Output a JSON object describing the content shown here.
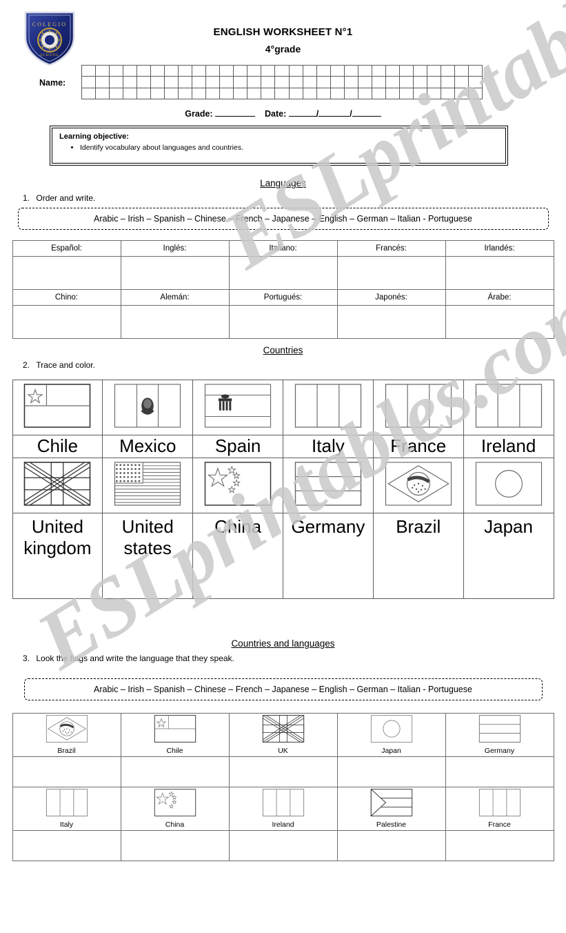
{
  "watermark": {
    "text": "ESLprintables.com"
  },
  "header": {
    "logo_alt": "school-crest-logo",
    "logo_text": "COLEGIO",
    "title": "ENGLISH WORKSHEET N°1",
    "subtitle": "4°grade"
  },
  "name_row": {
    "label": "Name:",
    "cell_columns": 29,
    "cell_rows": 3
  },
  "grade_date": {
    "grade_label": "Grade:",
    "date_label": "Date:",
    "separator": "/"
  },
  "objective": {
    "title": "Learning objective:",
    "items": [
      "Identify vocabulary about languages and countries."
    ]
  },
  "section1": {
    "heading": "Languages",
    "number": "1.",
    "instruction": "Order and write.",
    "wordbank": "Arabic – Irish – Spanish – Chinese – French – Japanese – English – German – Italian - Portuguese",
    "table_rows": [
      [
        "Español:",
        "Inglés:",
        "Italiano:",
        "Francés:",
        "Irlandés:"
      ],
      [
        "Chino:",
        "Alemán:",
        "Portugués:",
        "Japonés:",
        "Árabe:"
      ]
    ]
  },
  "section2": {
    "heading": "Countries",
    "number": "2.",
    "instruction": "Trace and color.",
    "rows": [
      [
        {
          "country": "Chile",
          "flag": "chile-flag"
        },
        {
          "country": "Mexico",
          "flag": "mexico-flag"
        },
        {
          "country": "Spain",
          "flag": "spain-flag"
        },
        {
          "country": "Italy",
          "flag": "italy-flag"
        },
        {
          "country": "France",
          "flag": "france-flag"
        },
        {
          "country": "Ireland",
          "flag": "ireland-flag"
        }
      ],
      [
        {
          "country": "United kingdom",
          "flag": "uk-flag"
        },
        {
          "country": "United states",
          "flag": "usa-flag"
        },
        {
          "country": "China",
          "flag": "china-flag"
        },
        {
          "country": "Germany",
          "flag": "germany-flag"
        },
        {
          "country": "Brazil",
          "flag": "brazil-flag"
        },
        {
          "country": "Japan",
          "flag": "japan-flag"
        }
      ]
    ]
  },
  "section3": {
    "heading": "Countries and languages",
    "number": "3.",
    "instruction": "Look the flags and write the language that they speak.",
    "wordbank": "Arabic – Irish – Spanish – Chinese – French – Japanese – English – German – Italian - Portuguese",
    "rows": [
      [
        {
          "country": "Brazil",
          "flag": "brazil-flag"
        },
        {
          "country": "Chile",
          "flag": "chile-flag"
        },
        {
          "country": "UK",
          "flag": "uk-flag"
        },
        {
          "country": "Japan",
          "flag": "japan-flag"
        },
        {
          "country": "Germany",
          "flag": "germany-flag"
        }
      ],
      [
        {
          "country": "Italy",
          "flag": "italy-flag"
        },
        {
          "country": "China",
          "flag": "china-flag"
        },
        {
          "country": "Ireland",
          "flag": "ireland-flag"
        },
        {
          "country": "Palestine",
          "flag": "palestine-flag"
        },
        {
          "country": "France",
          "flag": "france-flag"
        }
      ]
    ]
  },
  "colors": {
    "crest_blue": "#1b2a7a",
    "crest_gold": "#c8a23a",
    "rule": "#5d5d5d",
    "watermark": "#c9c9c9"
  }
}
